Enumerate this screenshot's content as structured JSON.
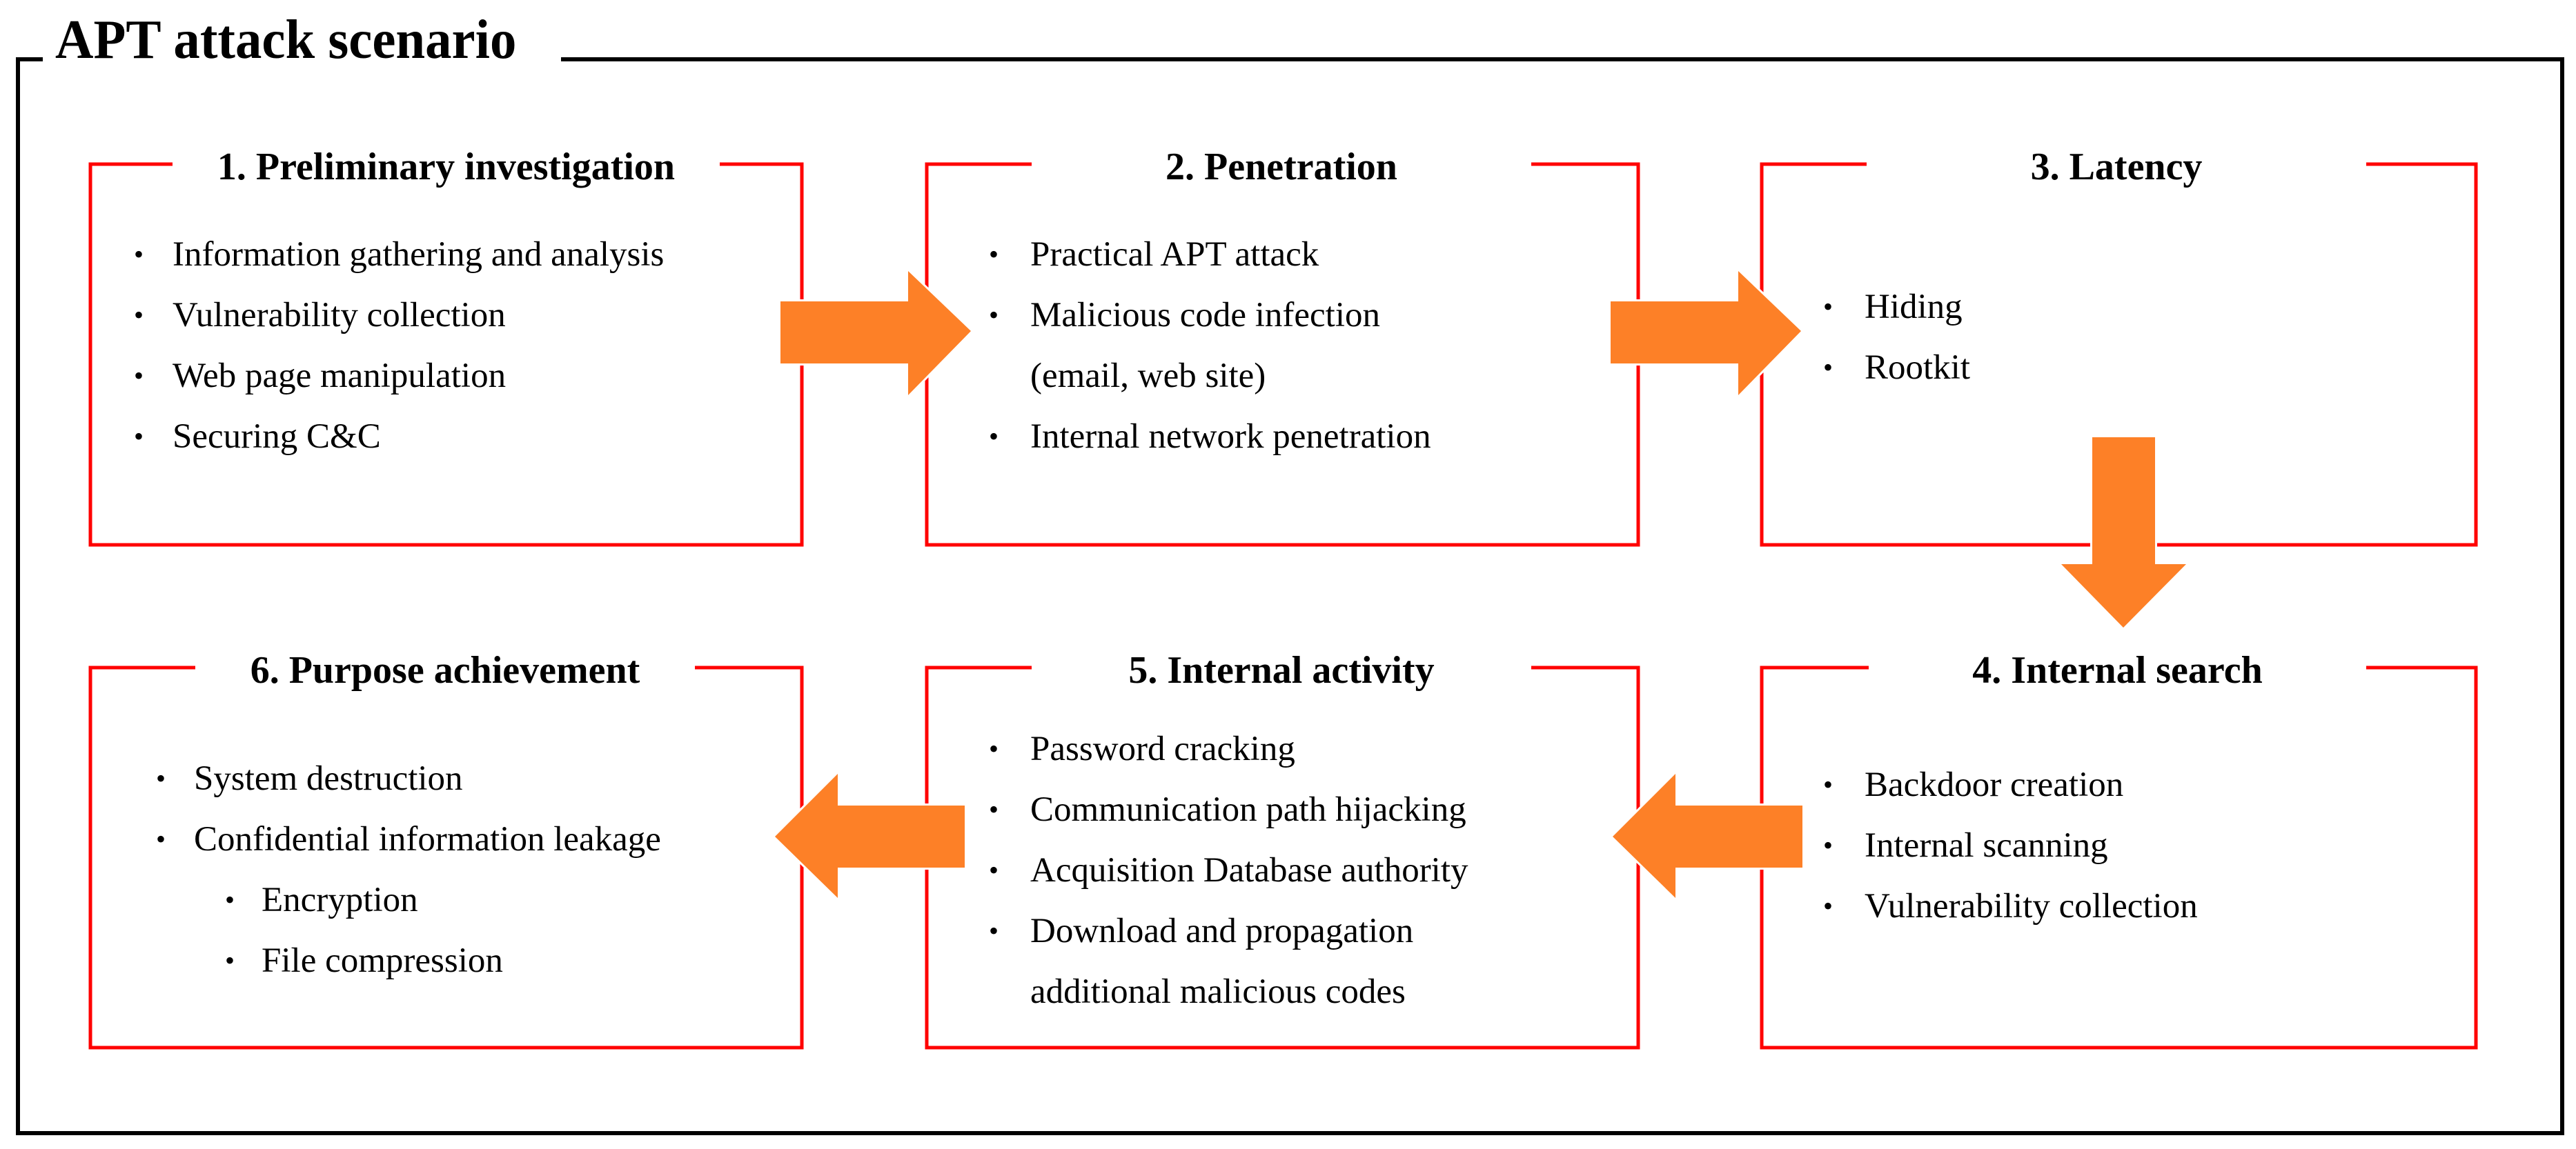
{
  "title": "APT attack scenario",
  "colors": {
    "frame": "#000000",
    "stage_border": "#ff0000",
    "arrow": "#fd8027",
    "text": "#000000"
  },
  "bullet_icon": "bullet-dot-icon",
  "stages": [
    {
      "number": 1,
      "heading": "1. Preliminary investigation",
      "items": [
        {
          "text": "Information gathering and analysis",
          "level": 1
        },
        {
          "text": "Vulnerability collection",
          "level": 1
        },
        {
          "text": "Web page manipulation",
          "level": 1
        },
        {
          "text": "Securing C&C",
          "level": 1
        }
      ]
    },
    {
      "number": 2,
      "heading": "2. Penetration",
      "items": [
        {
          "text": "Practical APT attack",
          "level": 1
        },
        {
          "text": "Malicious code infection",
          "level": 1
        },
        {
          "text": "(email, web site)",
          "level": 1,
          "continuation": true
        },
        {
          "text": "Internal network penetration",
          "level": 1
        }
      ]
    },
    {
      "number": 3,
      "heading": "3. Latency",
      "items": [
        {
          "text": "Hiding",
          "level": 1
        },
        {
          "text": "Rootkit",
          "level": 1
        }
      ]
    },
    {
      "number": 4,
      "heading": "4. Internal search",
      "items": [
        {
          "text": "Backdoor creation",
          "level": 1
        },
        {
          "text": "Internal scanning",
          "level": 1
        },
        {
          "text": "Vulnerability collection",
          "level": 1
        }
      ]
    },
    {
      "number": 5,
      "heading": "5. Internal activity",
      "items": [
        {
          "text": "Password cracking",
          "level": 1
        },
        {
          "text": "Communication path hijacking",
          "level": 1
        },
        {
          "text": "Acquisition Database authority",
          "level": 1
        },
        {
          "text": "Download and propagation",
          "level": 1
        },
        {
          "text": "additional malicious codes",
          "level": 1,
          "continuation": true
        }
      ]
    },
    {
      "number": 6,
      "heading": "6. Purpose achievement",
      "items": [
        {
          "text": "System destruction",
          "level": 1
        },
        {
          "text": "Confidential information leakage",
          "level": 1
        },
        {
          "text": "Encryption",
          "level": 2
        },
        {
          "text": "File compression",
          "level": 2
        }
      ]
    }
  ],
  "flow": [
    {
      "from": 1,
      "to": 2,
      "direction": "right"
    },
    {
      "from": 2,
      "to": 3,
      "direction": "right"
    },
    {
      "from": 3,
      "to": 4,
      "direction": "down"
    },
    {
      "from": 4,
      "to": 5,
      "direction": "left"
    },
    {
      "from": 5,
      "to": 6,
      "direction": "left"
    }
  ]
}
